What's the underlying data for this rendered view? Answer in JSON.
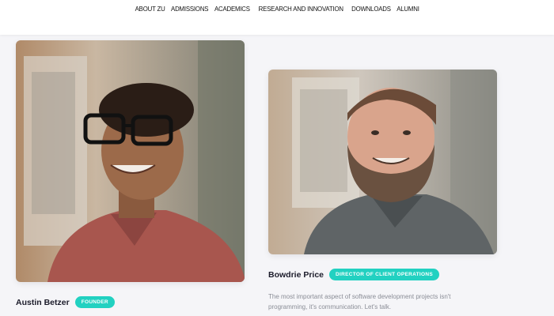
{
  "nav": {
    "items": [
      {
        "label": "ABOUT ZU"
      },
      {
        "label": "ADMISSIONS"
      },
      {
        "label": "ACADEMICS"
      },
      {
        "label": "RESEARCH AND INNOVATION"
      },
      {
        "label": "DOWNLOADS"
      },
      {
        "label": "ALUMNI"
      }
    ]
  },
  "team": [
    {
      "name": "Austin Betzer",
      "role": "FOUNDER",
      "bio": ""
    },
    {
      "name": "Bowdrie Price",
      "role": "DIRECTOR OF CLIENT OPERATIONS",
      "bio": "The most important aspect of software development projects isn't programming, it's communication. Let's talk."
    }
  ],
  "colors": {
    "accent": "#22d1c1",
    "background": "#f5f5f8",
    "text": "#1b1b2a",
    "muted": "#8a8d96"
  }
}
